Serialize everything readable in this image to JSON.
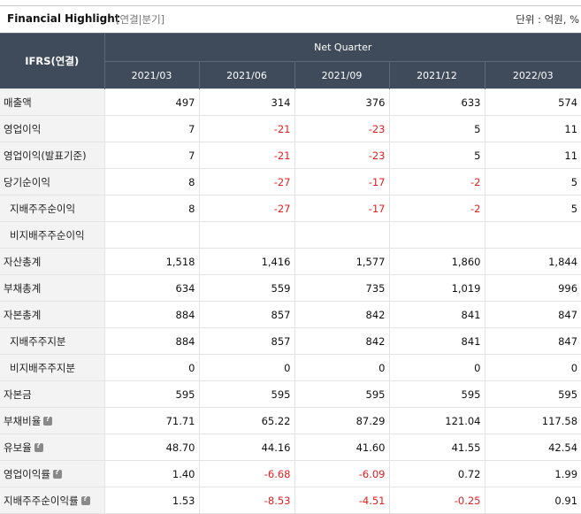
{
  "header": {
    "title": "Financial Highlight",
    "subtitle": "[연결|분기]",
    "unit": "단위 : 억원, %"
  },
  "table": {
    "row_header": "IFRS(연결)",
    "group_header": "Net Quarter",
    "columns": [
      "2021/03",
      "2021/06",
      "2021/09",
      "2021/12",
      "2022/03"
    ],
    "rows": [
      {
        "label": "매출액",
        "values": [
          "497",
          "314",
          "376",
          "633",
          "574"
        ]
      },
      {
        "label": "영업이익",
        "values": [
          "7",
          "-21",
          "-23",
          "5",
          "11"
        ]
      },
      {
        "label": "영업이익(발표기준)",
        "values": [
          "7",
          "-21",
          "-23",
          "5",
          "11"
        ]
      },
      {
        "label": "당기순이익",
        "values": [
          "8",
          "-27",
          "-17",
          "-2",
          "5"
        ]
      },
      {
        "label": "지배주주순이익",
        "values": [
          "8",
          "-27",
          "-17",
          "-2",
          "5"
        ]
      },
      {
        "label": "비지배주주순이익",
        "values": [
          "",
          "",
          "",
          "",
          ""
        ]
      },
      {
        "label": "자산총계",
        "values": [
          "1,518",
          "1,416",
          "1,577",
          "1,860",
          "1,844"
        ]
      },
      {
        "label": "부채총계",
        "values": [
          "634",
          "559",
          "735",
          "1,019",
          "996"
        ]
      },
      {
        "label": "자본총계",
        "values": [
          "884",
          "857",
          "842",
          "841",
          "847"
        ]
      },
      {
        "label": "지배주주지분",
        "values": [
          "884",
          "857",
          "842",
          "841",
          "847"
        ]
      },
      {
        "label": "비지배주주지분",
        "values": [
          "0",
          "0",
          "0",
          "0",
          "0"
        ]
      },
      {
        "label": "자본금",
        "values": [
          "595",
          "595",
          "595",
          "595",
          "595"
        ]
      },
      {
        "label": "부채비율",
        "values": [
          "71.71",
          "65.22",
          "87.29",
          "121.04",
          "117.58"
        ]
      },
      {
        "label": "유보율",
        "values": [
          "48.70",
          "44.16",
          "41.60",
          "41.55",
          "42.54"
        ]
      },
      {
        "label": "영업이익률",
        "values": [
          "1.40",
          "-6.68",
          "-6.09",
          "0.72",
          "1.99"
        ]
      },
      {
        "label": "지배주주순이익률",
        "values": [
          "1.53",
          "-8.53",
          "-4.51",
          "-0.25",
          "0.91"
        ]
      }
    ]
  },
  "colors": {
    "header_bg": "#3f4a5b",
    "negative": "#e02020",
    "label_bg": "#f3f3f3"
  }
}
